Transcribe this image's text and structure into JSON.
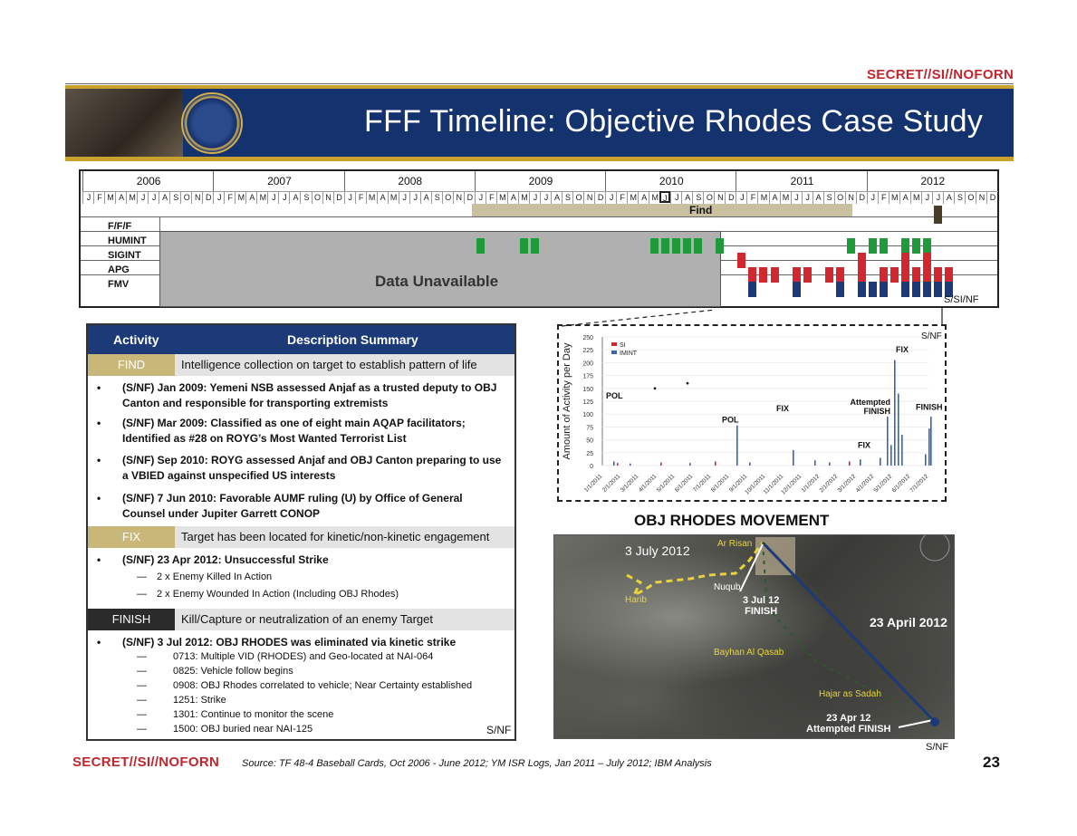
{
  "classification": "SECRET//SI//NOFORN",
  "banner": {
    "title": "FFF Timeline: Objective Rhodes Case Study"
  },
  "timeline": {
    "years": [
      "2006",
      "2007",
      "2008",
      "2009",
      "2010",
      "2011",
      "2012"
    ],
    "months": [
      "J",
      "F",
      "M",
      "A",
      "M",
      "J",
      "J",
      "A",
      "S",
      "O",
      "N",
      "D"
    ],
    "rows": [
      "F/F/F",
      "HUMINT",
      "SIGINT",
      "APG",
      "FMV"
    ],
    "unavailable": "Data Unavailable",
    "find": "Find",
    "marking": "S/SI/NF"
  },
  "activity": {
    "header_activity": "Activity",
    "header_summary": "Description Summary",
    "find_tag": "FIND",
    "find_desc": "Intelligence collection on target to establish pattern of life",
    "find_bullets": [
      "(S/NF) Jan 2009: Yemeni NSB assessed Anjaf as a trusted deputy to OBJ Canton and responsible for transporting extremists",
      "(S/NF) Mar 2009: Classified as one of eight main AQAP facilitators; Identified as #28 on ROYG’s Most Wanted Terrorist List",
      "(S/NF) Sep 2010: ROYG assessed Anjaf and OBJ Canton preparing to use a VBIED against unspecified US interests",
      "(S/NF) 7 Jun 2010: Favorable AUMF ruling (U) by Office of General Counsel under Jupiter Garrett CONOP"
    ],
    "fix_tag": "FIX",
    "fix_desc": "Target has been located for kinetic/non-kinetic engagement",
    "fix_bullet": "(S/NF) 23 Apr 2012: Unsuccessful Strike",
    "fix_subs": [
      "2 x Enemy Killed In Action",
      "2 x Enemy Wounded In Action (Including OBJ Rhodes)"
    ],
    "finish_tag": "FINISH",
    "finish_desc": "Kill/Capture or neutralization of an enemy Target",
    "finish_bullet": "(S/NF) 3 Jul 2012: OBJ RHODES was eliminated via kinetic strike",
    "finish_subs": [
      "0713: Multiple VID (RHODES) and Geo-located at NAI-064",
      "0825: Vehicle follow begins",
      "0908: OBJ Rhodes correlated to vehicle; Near Certainty established",
      "1251: Strike",
      "1301: Continue to monitor the scene",
      "1500: OBJ buried near NAI-125"
    ],
    "marking": "S/NF"
  },
  "chart_data": {
    "type": "bar",
    "ylabel": "Amount of Activity per Day",
    "yticks": [
      0,
      25,
      50,
      75,
      100,
      125,
      150,
      175,
      200,
      225,
      250
    ],
    "ylim": [
      0,
      250
    ],
    "xticks": [
      "1/1/2011",
      "2/1/2011",
      "3/1/2011",
      "4/1/2011",
      "5/1/2011",
      "6/1/2011",
      "7/1/2011",
      "8/1/2011",
      "9/1/2011",
      "10/1/2011",
      "11/1/2011",
      "12/1/2011",
      "1/1/2012",
      "2/1/2012",
      "3/1/2012",
      "4/1/2012",
      "5/1/2012",
      "6/1/2012",
      "7/1/2012"
    ],
    "series": [
      {
        "name": "SI",
        "color": "#d0282e"
      },
      {
        "name": "IMINT",
        "color": "#3a63b8"
      }
    ],
    "annotations": [
      "POL",
      "POL",
      "FIX",
      "Attempted FINISH",
      "FIX",
      "FIX",
      "FINISH"
    ],
    "marking": "S/NF",
    "bars": [
      {
        "x": 0.6,
        "v": 8,
        "s": 1
      },
      {
        "x": 0.8,
        "v": 5,
        "s": 0
      },
      {
        "x": 1.5,
        "v": 4,
        "s": 1
      },
      {
        "x": 3.2,
        "v": 6,
        "s": 0
      },
      {
        "x": 4.8,
        "v": 5,
        "s": 1
      },
      {
        "x": 6.2,
        "v": 8,
        "s": 0
      },
      {
        "x": 7.4,
        "v": 78,
        "s": 1
      },
      {
        "x": 8.1,
        "v": 6,
        "s": 1
      },
      {
        "x": 10.5,
        "v": 30,
        "s": 1
      },
      {
        "x": 11.7,
        "v": 10,
        "s": 1
      },
      {
        "x": 12.5,
        "v": 6,
        "s": 1
      },
      {
        "x": 13.6,
        "v": 8,
        "s": 0
      },
      {
        "x": 14.2,
        "v": 12,
        "s": 1
      },
      {
        "x": 15.3,
        "v": 15,
        "s": 1
      },
      {
        "x": 15.7,
        "v": 95,
        "s": 1
      },
      {
        "x": 15.9,
        "v": 40,
        "s": 1
      },
      {
        "x": 16.1,
        "v": 205,
        "s": 1
      },
      {
        "x": 16.3,
        "v": 140,
        "s": 1
      },
      {
        "x": 16.5,
        "v": 60,
        "s": 1
      },
      {
        "x": 17.8,
        "v": 22,
        "s": 1
      },
      {
        "x": 18.0,
        "v": 72,
        "s": 1
      },
      {
        "x": 18.1,
        "v": 95,
        "s": 1
      }
    ]
  },
  "movement": {
    "title": "OBJ RHODES MOVEMENT",
    "label_3july": "3 July 2012",
    "label_23april": "23 April 2012",
    "label_finish": "3 Jul 12\nFINISH",
    "label_attempted": "23 Apr 12\nAttempted FINISH",
    "places": [
      "Ar Risan",
      "Harib",
      "Nuqub",
      "Bayhan Al Qasab",
      "Hajar as Sadah"
    ],
    "marking": "S/NF"
  },
  "footer": {
    "source": "Source: TF 48-4 Baseball Cards, Oct 2006 - June 2012; YM ISR Logs, Jan 2011 – July 2012; IBM Analysis",
    "page": "23"
  }
}
